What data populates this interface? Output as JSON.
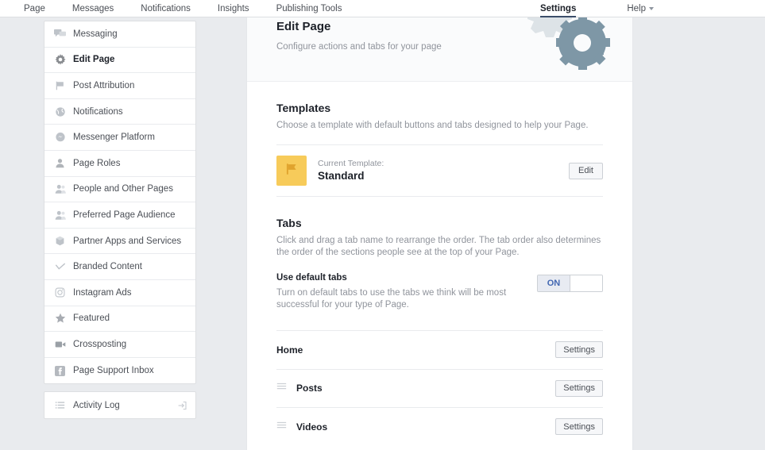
{
  "topnav": {
    "left_items": [
      {
        "label": "Page"
      },
      {
        "label": "Messages"
      },
      {
        "label": "Notifications"
      },
      {
        "label": "Insights"
      },
      {
        "label": "Publishing Tools"
      }
    ],
    "settings_label": "Settings",
    "help_label": "Help"
  },
  "sidebar": {
    "items": [
      {
        "label": "Messaging",
        "icon": "messaging-icon"
      },
      {
        "label": "Edit Page",
        "icon": "gear-icon"
      },
      {
        "label": "Post Attribution",
        "icon": "flag-icon"
      },
      {
        "label": "Notifications",
        "icon": "globe-icon"
      },
      {
        "label": "Messenger Platform",
        "icon": "messenger-icon"
      },
      {
        "label": "Page Roles",
        "icon": "person-icon"
      },
      {
        "label": "People and Other Pages",
        "icon": "people-icon"
      },
      {
        "label": "Preferred Page Audience",
        "icon": "people-icon"
      },
      {
        "label": "Partner Apps and Services",
        "icon": "apps-icon"
      },
      {
        "label": "Branded Content",
        "icon": "branded-icon"
      },
      {
        "label": "Instagram Ads",
        "icon": "instagram-icon"
      },
      {
        "label": "Featured",
        "icon": "star-icon"
      },
      {
        "label": "Crossposting",
        "icon": "video-icon"
      },
      {
        "label": "Page Support Inbox",
        "icon": "facebook-icon"
      }
    ],
    "activity_log": {
      "label": "Activity Log",
      "icon": "list-icon",
      "action_icon": "external-link-icon"
    }
  },
  "header": {
    "title": "Edit Page",
    "subtitle": "Configure actions and tabs for your page",
    "art": "gear-illustration"
  },
  "templates": {
    "title": "Templates",
    "description": "Choose a template with default buttons and tabs designed to help your Page.",
    "current_label": "Current Template:",
    "current_name": "Standard",
    "edit_button": "Edit",
    "thumb_color": "#f7cb5a",
    "thumb_icon": "flag-icon"
  },
  "tabs": {
    "title": "Tabs",
    "description": "Click and drag a tab name to rearrange the order. The tab order also determines the order of the sections people see at the top of your Page.",
    "default_tabs": {
      "label": "Use default tabs",
      "description": "Turn on default tabs to use the tabs we think will be most successful for your type of Page.",
      "toggle_on_label": "ON",
      "toggle_state": "on",
      "toggle_accent": "#4267b2"
    },
    "rows": [
      {
        "name": "Home",
        "button": "Settings",
        "draggable": false
      },
      {
        "name": "Posts",
        "button": "Settings",
        "draggable": true
      },
      {
        "name": "Videos",
        "button": "Settings",
        "draggable": true
      }
    ]
  }
}
